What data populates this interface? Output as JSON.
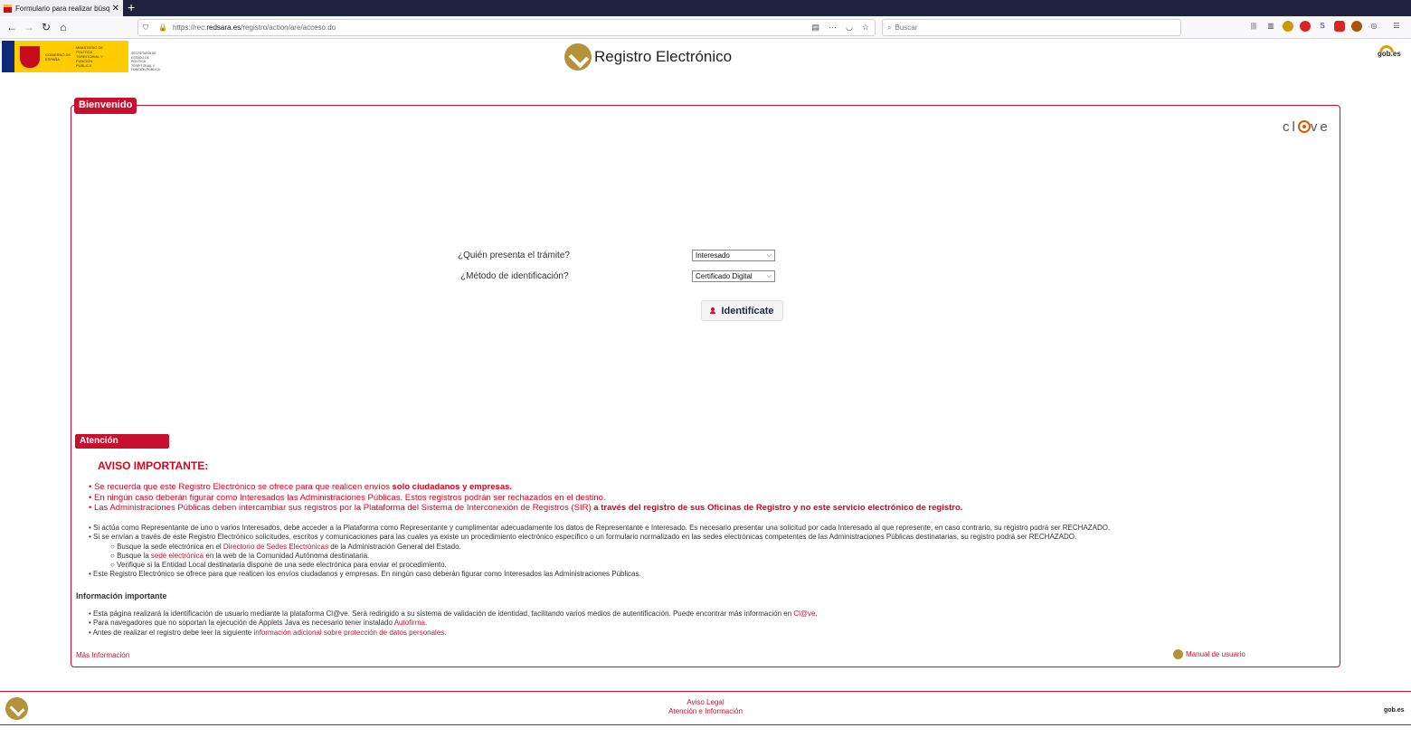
{
  "browser": {
    "tab_title": "Formulario para realizar búsqu",
    "tab_close": "✕",
    "new_tab": "+",
    "url_prefix": "https://rec.",
    "url_domain": "redsara.es",
    "url_path": "/registro/action/are/acceso.do",
    "search_placeholder": "Buscar"
  },
  "header": {
    "gov_text": "GOBIERNO DE ESPAÑA",
    "ministry_text": "MINISTERIO DE POLÍTICA TERRITORIAL Y FUNCIÓN PÚBLICA",
    "secretary_text": "SECRETARÍA DE ESTADO DE POLÍTICA TERRITORIAL Y FUNCIÓN PÚBLICA",
    "site_title": "Registro Electrónico",
    "gob_logo": "gob.es"
  },
  "welcome": {
    "legend": "Bienvenido",
    "clave_left": "cl",
    "clave_right": "ve"
  },
  "form": {
    "quien_label": "¿Quién presenta el trámite?",
    "quien_value": "Interesado",
    "metodo_label": "¿Método de identificación?",
    "metodo_value": "Certificado Digital",
    "button_label": "Identifícate"
  },
  "attention": {
    "legend": "Atención",
    "aviso_title": "AVISO IMPORTANTE:",
    "red_1a": "Se recuerda que este Registro Electrónico se ofrece para que realicen envíos ",
    "red_1b": "solo ciudadanos y empresas.",
    "red_2": "En ningún caso deberán figurar como Interesados las Administraciones Públicas. Estos registros podrán ser rechazados en el destino.",
    "red_3a": "Las Administraciones Públicas deben intercambiar sus registros por la Plataforma del Sistema de Interconexión de Registros (SIR) ",
    "red_3b": "a través del registro de sus Oficinas de Registro y no este servicio electrónico de registro.",
    "grey_1": "Si actúa como Representante de uno o varios Interesados, debe acceder a la Plataforma como Representante y cumplimentar adecuadamente los datos de Representante e Interesado. Es necesario presentar una solicitud por cada Interesado al que represente, en caso contrario, su registro podrá ser RECHAZADO.",
    "grey_2": "Si se envían a través de este Registro Electrónico solicitudes, escritos y comunicaciones para las cuales ya existe un procedimiento electrónico específico o un formulario normalizado en las sedes electrónicas competentes de las Administraciones Públicas destinatarias, su registro podrá ser RECHAZADO.",
    "sub_1a": "Busque la sede electrónica en el ",
    "sub_1_link": "Directorio de Sedes Electrónicas",
    "sub_1b": " de la Administración General del Estado.",
    "sub_2a": "Busque la ",
    "sub_2_link": "sede electrónica",
    "sub_2b": " en la web de la Comunidad Autónoma destinataria.",
    "sub_3": "Verifique si la Entidad Local destinataria dispone de una sede electrónica para enviar el procedimiento.",
    "grey_3": "Este Registro Electrónico se ofrece para que realicen los envíos ciudadanos y empresas. En ningún caso deberán figurar como Interesados las Administraciones Públicas."
  },
  "info": {
    "title": "Información importante",
    "item_1a": "Esta página realizará la identificación de usuario mediante la plataforma Cl@ve. Será redirigido a su sistema de validación de identidad, facilitando varios medios de autentificación. Puede encontrar más información en ",
    "item_1_link": "Cl@ve",
    "item_1b": ".",
    "item_2a": "Para navegadores que no soportan la ejecución de Applets Java es necesario tener instalado ",
    "item_2_link": "Autofirma",
    "item_2b": ".",
    "item_3a": "Antes de realizar el registro debe leer la siguiente ",
    "item_3_link": "información adicional sobre protección de datos personales",
    "item_3b": ".",
    "mas_info": "Más Información",
    "manual": "Manual de usuario"
  },
  "footer": {
    "aviso_legal": "Aviso Legal",
    "atencion_info": "Atención e Información",
    "gob_logo": "gob.es"
  },
  "colors": {
    "accent": "#c8102e",
    "warning_red": "#e0001b",
    "gold": "#b3923a",
    "chrome_dark": "#1f2340"
  }
}
